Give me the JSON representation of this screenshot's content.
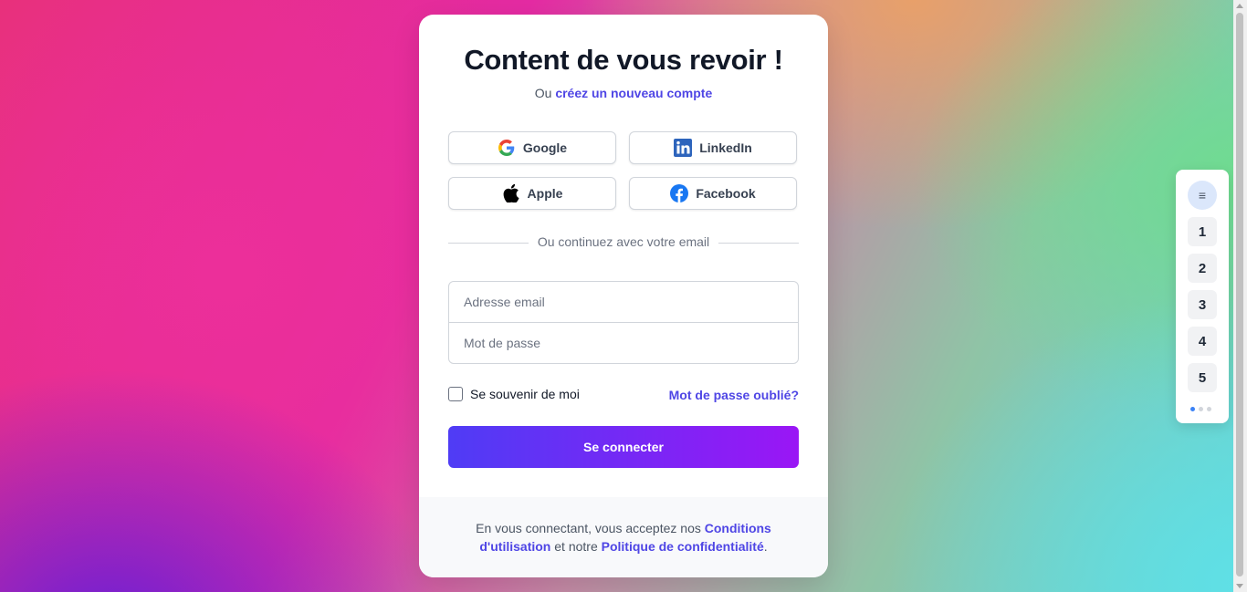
{
  "login": {
    "title": "Content de vous revoir !",
    "subtitle_prefix": "Ou",
    "create_account_link": "créez un nouveau compte",
    "social": {
      "google": "Google",
      "linkedin": "LinkedIn",
      "apple": "Apple",
      "facebook": "Facebook"
    },
    "divider_text": "Ou continuez avec votre email",
    "email_placeholder": "Adresse email",
    "password_placeholder": "Mot de passe",
    "remember_label": "Se souvenir de moi",
    "forgot_link": "Mot de passe oublié?",
    "submit_label": "Se connecter",
    "footer": {
      "prefix": "En vous connectant, vous acceptez nos",
      "terms_link": "Conditions d'utilisation",
      "middle": "et notre",
      "privacy_link": "Politique de confidentialité",
      "suffix": "."
    }
  },
  "pager": {
    "menu_icon": "≡",
    "pages": [
      "1",
      "2",
      "3",
      "4",
      "5"
    ]
  },
  "colors": {
    "accent": "#4f46e5",
    "button_gradient_start": "#4f3cf5",
    "button_gradient_end": "#9a16f5"
  }
}
